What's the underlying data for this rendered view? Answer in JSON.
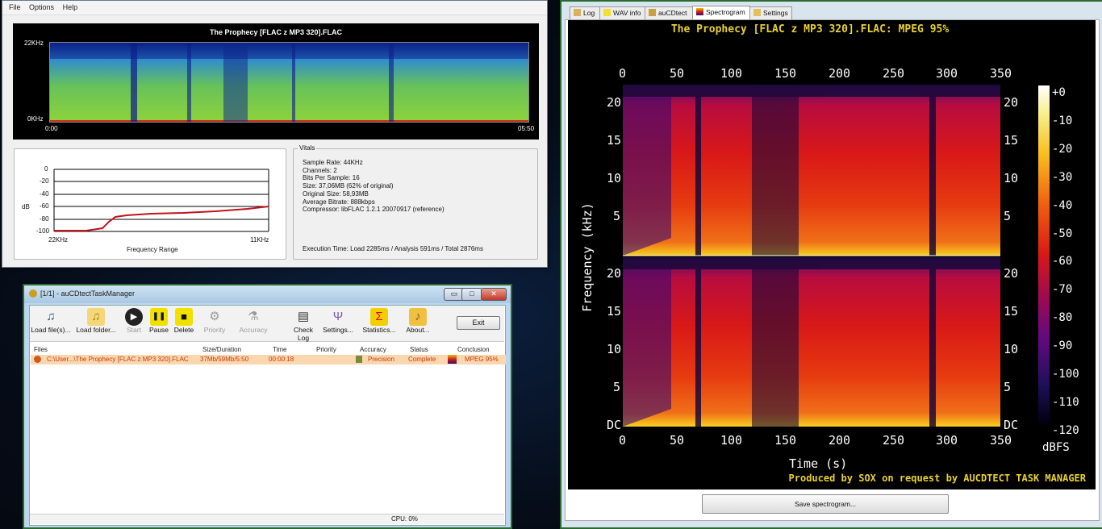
{
  "menu": {
    "items": [
      "File",
      "Options",
      "Help"
    ]
  },
  "analysis": {
    "spectrogram_title": "The Prophecy [FLAC z MP3 320].FLAC",
    "freq_top": "22KHz",
    "freq_bottom": "0KHz",
    "time_start": "0:00",
    "time_end": "05:50",
    "db_ticks": [
      "0",
      "-20",
      "-40",
      "-60",
      "-80",
      "-100"
    ],
    "db_axis_label": "dB",
    "freq_left": "22KHz",
    "freq_right": "11KHz",
    "freq_range_label": "Frequency Range",
    "vitals_title": "Vitals",
    "vitals": [
      "Sample Rate: 44KHz",
      "Channels: 2",
      "Bits Per Sample: 16",
      "Size: 37,06MB (62% of original)",
      "Original Size: 58,93MB",
      "Average Bitrate: 888kbps",
      "Compressor: libFLAC 1.2.1 20070917 (reference)"
    ],
    "execution_time": "Execution Time: Load 2285ms / Analysis 591ms / Total 2876ms",
    "colors": {
      "curve": "#c0141b"
    }
  },
  "taskmanager": {
    "title": "[1/1] - auCDtectTaskManager",
    "window_buttons": [
      "▭",
      "□",
      "✕"
    ],
    "toolbar": [
      {
        "label": "Load file(s)...",
        "icon": "music-note-icon",
        "glyph": "♫"
      },
      {
        "label": "Load folder...",
        "icon": "folder-music-icon",
        "glyph": "♫"
      },
      {
        "label": "Start",
        "icon": "play-icon",
        "glyph": "▶"
      },
      {
        "label": "Pause",
        "icon": "pause-icon",
        "glyph": "❚❚"
      },
      {
        "label": "Delete",
        "icon": "stop-icon",
        "glyph": "■"
      },
      {
        "label": "Priority",
        "icon": "bicycle-icon",
        "glyph": "⚙"
      },
      {
        "label": "Accuracy",
        "icon": "microscope-icon",
        "glyph": "⚗"
      },
      {
        "label": "Check Log",
        "icon": "log-icon",
        "glyph": "▤"
      },
      {
        "label": "Settings...",
        "icon": "tuning-fork-icon",
        "glyph": "Ψ"
      },
      {
        "label": "Statistics...",
        "icon": "sigma-icon",
        "glyph": "Σ"
      },
      {
        "label": "About...",
        "icon": "about-icon",
        "glyph": "♪"
      }
    ],
    "exit_label": "Exit",
    "columns": [
      "Files",
      "Size/Duration",
      "Time",
      "Priority",
      "Accuracy",
      "Status",
      "Conclusion"
    ],
    "rows": [
      {
        "file": "C:\\User...\\The Prophecy [FLAC z MP3 320].FLAC",
        "size": "37Mb/59Mb/5:50",
        "time": "00:00:18",
        "priority": "",
        "accuracy": "Precision",
        "status": "Complete",
        "conclusion": "MPEG 95%"
      }
    ],
    "cpu": "CPU: 0%"
  },
  "rightpanel": {
    "tabs": [
      "Log",
      "WAV info",
      "auCDtect",
      "Spectrogram",
      "Settings"
    ],
    "active_tab": "Spectrogram",
    "title": "The Prophecy [FLAC z MP3 320].FLAC: MPEG 95%",
    "x_ticks": [
      "0",
      "50",
      "100",
      "150",
      "200",
      "250",
      "300",
      "350"
    ],
    "y_ticks_top": [
      "20",
      "15",
      "10",
      "5"
    ],
    "y_ticks_bottom": [
      "20",
      "15",
      "10",
      "5",
      "DC"
    ],
    "y_axis_label": "Frequency (kHz)",
    "x_axis_label": "Time (s)",
    "colorbar_ticks": [
      "+0",
      "-10",
      "-20",
      "-30",
      "-40",
      "-50",
      "-60",
      "-70",
      "-80",
      "-90",
      "-100",
      "-110",
      "-120"
    ],
    "colorbar_unit": "dBFS",
    "footer": "Produced by SOX on request by AUCDTECT TASK MANAGER",
    "save_button": "Save spectrogram..."
  }
}
